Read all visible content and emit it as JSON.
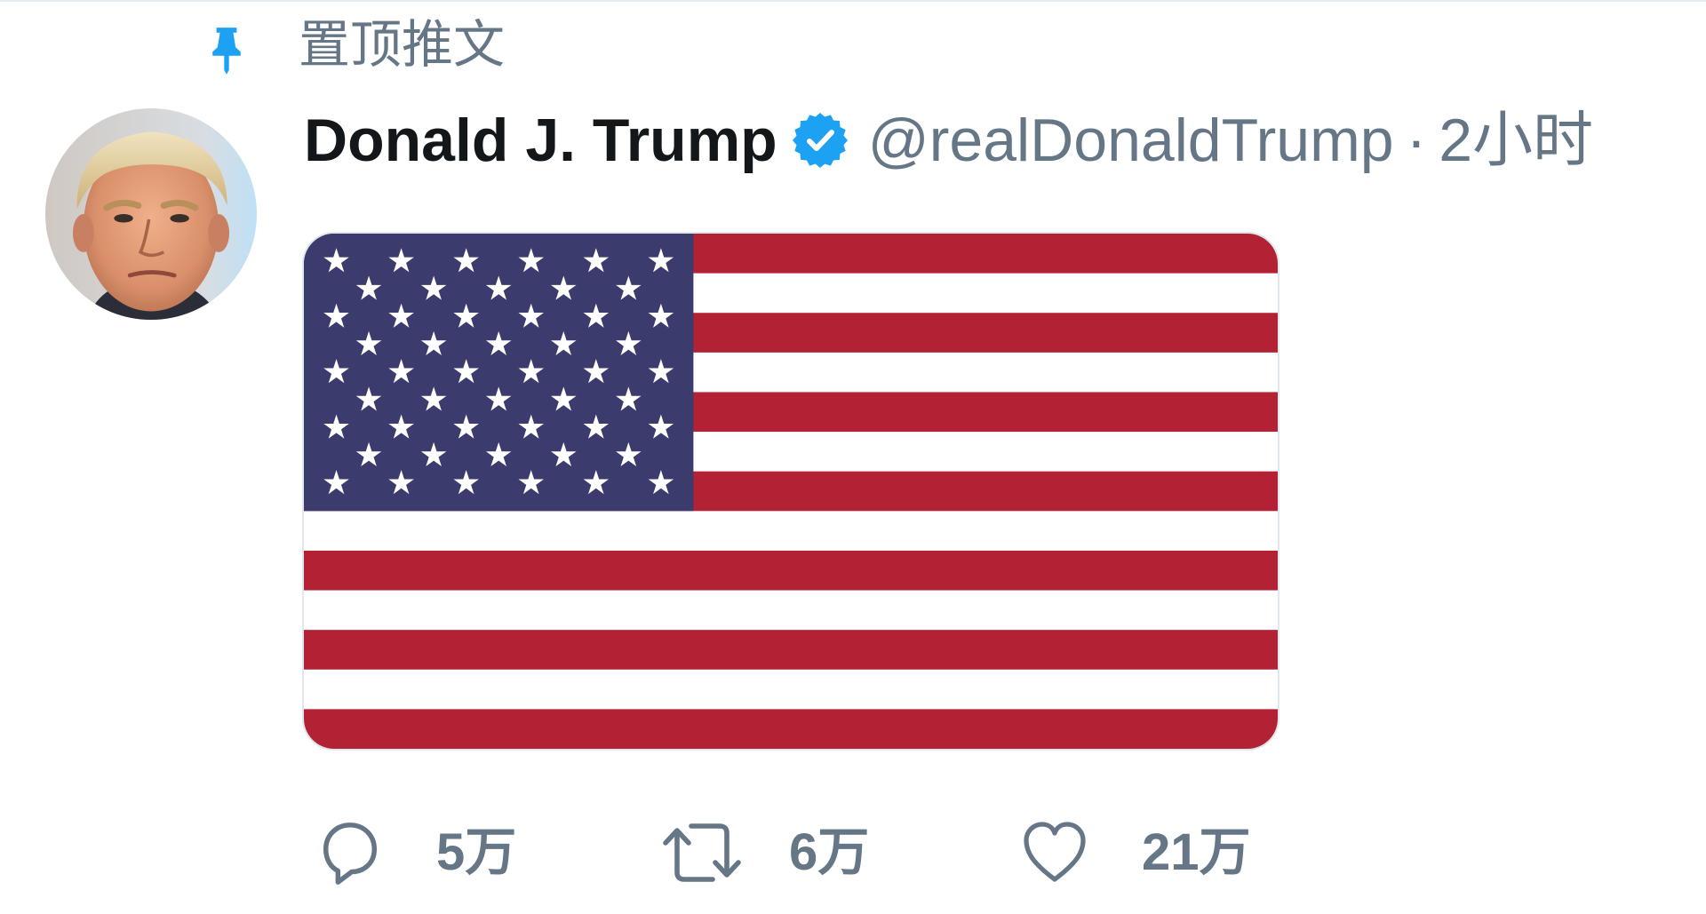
{
  "pinned": {
    "label": "置顶推文",
    "icon": "pin-icon"
  },
  "tweet": {
    "author_name": "Donald J. Trump",
    "verified_icon": "verified-badge-icon",
    "handle": "@realDonaldTrump",
    "separator": "·",
    "time": "2小时"
  },
  "media": {
    "kind": "us-flag-image",
    "flag": {
      "stripe_count": 13,
      "star_rows": [
        6,
        5,
        6,
        5,
        6,
        5,
        6,
        5,
        6
      ],
      "red": "#b22234",
      "white": "#ffffff",
      "blue": "#3c3b6e",
      "star": "#ffffff"
    }
  },
  "actions": {
    "reply": {
      "icon": "reply-icon",
      "count": "5万"
    },
    "retweet": {
      "icon": "retweet-icon",
      "count": "6万"
    },
    "like": {
      "icon": "heart-icon",
      "count": "21万"
    }
  },
  "colors": {
    "accent": "#1da1f2",
    "text_primary": "#14171a",
    "text_secondary": "#657786",
    "border": "#e1e8ed"
  }
}
